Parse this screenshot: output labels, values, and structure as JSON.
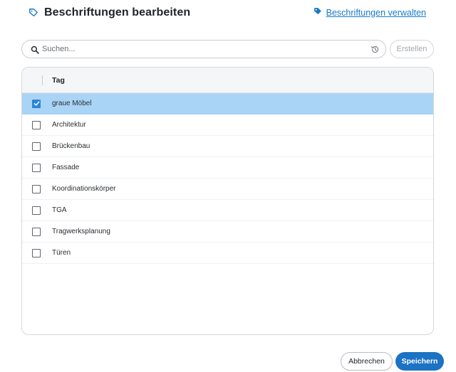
{
  "dialog": {
    "title": "Beschriftungen bearbeiten",
    "title_icon": "tag-outline-icon",
    "manage_link": "Beschriftungen verwalten",
    "manage_icon": "tag-filled-icon"
  },
  "search": {
    "placeholder": "Suchen...",
    "value": "",
    "search_icon": "search-icon",
    "history_icon": "history-icon"
  },
  "create_label": "Erstellen",
  "table": {
    "column_header": "Tag",
    "rows": [
      {
        "label": "graue Möbel",
        "checked": true
      },
      {
        "label": "Architektur",
        "checked": false
      },
      {
        "label": "Brückenbau",
        "checked": false
      },
      {
        "label": "Fassade",
        "checked": false
      },
      {
        "label": "Koordinationskörper",
        "checked": false
      },
      {
        "label": "TGA",
        "checked": false
      },
      {
        "label": "Tragwerksplanung",
        "checked": false
      },
      {
        "label": "Türen",
        "checked": false
      }
    ]
  },
  "footer": {
    "cancel_label": "Abbrechen",
    "save_label": "Speichern"
  },
  "colors": {
    "accent": "#1c72c3",
    "link": "#1a7ac7",
    "selected_row": "#a9d4f5",
    "checkbox_checked": "#2a85d6"
  }
}
